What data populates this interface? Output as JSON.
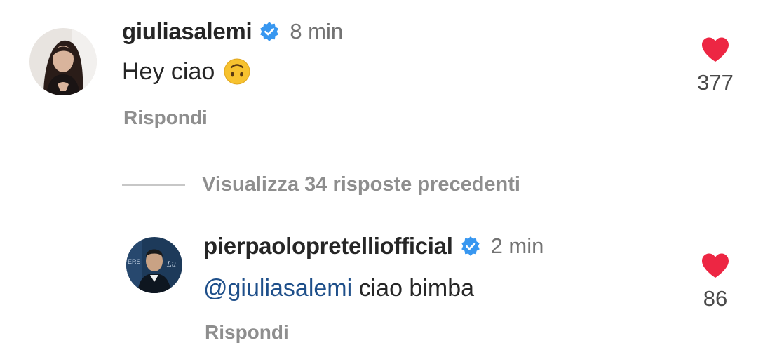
{
  "comments": [
    {
      "username": "giuliasalemi",
      "verified": true,
      "timestamp": "8 min",
      "text": "Hey ciao",
      "emoji": "upside-down-face-emoji",
      "reply_label": "Rispondi",
      "like_count": "377",
      "liked": true
    },
    {
      "username": "pierpaolopretelliofficial",
      "verified": true,
      "timestamp": "2 min",
      "mention": "@giuliasalemi",
      "text": " ciao bimba",
      "reply_label": "Rispondi",
      "like_count": "86",
      "liked": true
    }
  ],
  "view_replies": {
    "label": "Visualizza 34 risposte precedenti"
  },
  "colors": {
    "heart": "#ed2643",
    "verified": "#3897f0",
    "mention": "#1e4f8a",
    "secondary_text": "#8e8e8e"
  },
  "icons": {
    "verified": "verified-badge-icon",
    "like": "heart-icon"
  }
}
